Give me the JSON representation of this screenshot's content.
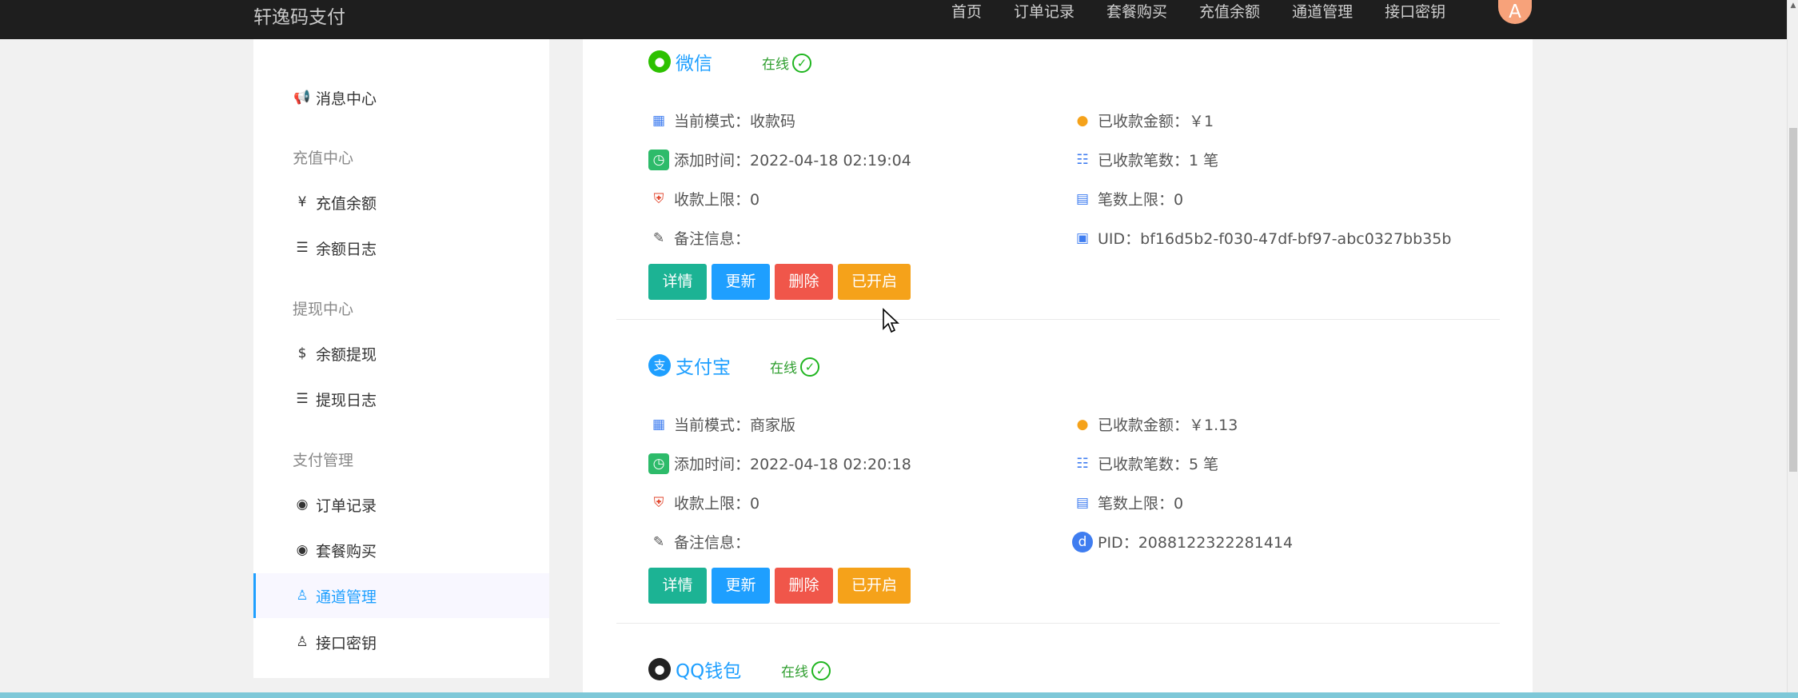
{
  "navbar": {
    "brand": "轩逸码支付",
    "links": [
      "首页",
      "订单记录",
      "套餐购买",
      "充值余额",
      "通道管理",
      "接口密钥"
    ],
    "avatar": "A"
  },
  "sidebar": {
    "message_center": "消息中心",
    "groups": {
      "recharge": "充值中心",
      "withdraw": "提现中心",
      "payment": "支付管理"
    },
    "items": {
      "recharge_balance": "充值余额",
      "balance_log": "余额日志",
      "balance_withdraw": "余额提现",
      "withdraw_log": "提现日志",
      "order_records": "订单记录",
      "package_purchase": "套餐购买",
      "channel_manage": "通道管理",
      "api_key": "接口密钥"
    },
    "icons": {
      "message_center": "megaphone-icon",
      "recharge_balance": "yen-icon",
      "balance_log": "list-icon",
      "balance_withdraw": "dollar-icon",
      "withdraw_log": "list-icon",
      "order_records": "user-circle-icon",
      "package_purchase": "user-circle-icon",
      "channel_manage": "user-icon",
      "api_key": "user-icon"
    }
  },
  "channels": [
    {
      "name": "微信",
      "status": "在线",
      "mode": "当前模式：收款码",
      "added": "添加时间：2022-04-18 02:19:04",
      "limit": "收款上限：0",
      "note": "备注信息：",
      "amount": "已收款金额：￥1",
      "count": "已收款笔数：1 笔",
      "count_limit": "笔数上限：0",
      "id_line": "UID：bf16d5b2-f030-47df-bf97-abc0327bb35b"
    },
    {
      "name": "支付宝",
      "status": "在线",
      "mode": "当前模式：商家版",
      "added": "添加时间：2022-04-18 02:20:18",
      "limit": "收款上限：0",
      "note": "备注信息：",
      "amount": "已收款金额：￥1.13",
      "count": "已收款笔数：5 笔",
      "count_limit": "笔数上限：0",
      "id_line": "PID：2088122322281414"
    },
    {
      "name": "QQ钱包",
      "status": "在线"
    }
  ],
  "buttons": {
    "detail": "详情",
    "update": "更新",
    "delete": "删除",
    "opened": "已开启"
  },
  "colors": {
    "accent": "#1e9fff",
    "online": "#2e9e2e",
    "btn_detail": "#1cb394",
    "btn_update": "#1e9fff",
    "btn_delete": "#f0564a",
    "btn_open": "#f5a21a"
  }
}
